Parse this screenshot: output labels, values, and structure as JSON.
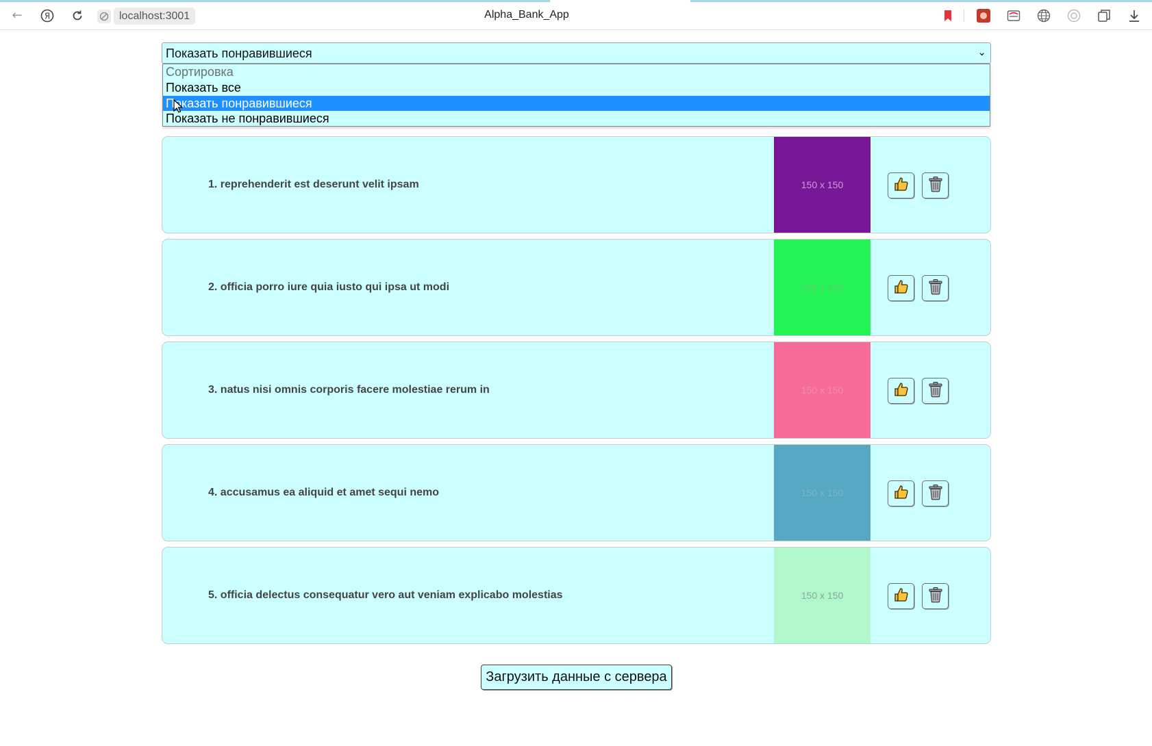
{
  "browser": {
    "url": "localhost:3001",
    "title": "Alpha_Bank_App",
    "icons": [
      "back-icon",
      "yandex-icon",
      "reload-icon",
      "site-info-icon",
      "bookmark-icon",
      "extension-icon",
      "reader-icon",
      "translate-icon",
      "alice-icon",
      "collections-icon",
      "download-icon"
    ]
  },
  "sort": {
    "selected": "Показать понравившиеся",
    "options": [
      {
        "label": "Сортировка",
        "disabled": true
      },
      {
        "label": "Показать все"
      },
      {
        "label": "Показать понравившиеся",
        "selected": true
      },
      {
        "label": "Показать не понравившиеся"
      }
    ]
  },
  "cards": [
    {
      "title": "1. reprehenderit est deserunt velit ipsam",
      "image_label": "150 x 150",
      "image_color": "#771796",
      "text_color": "#c99cd4"
    },
    {
      "title": "2. officia porro iure quia iusto qui ipsa ut modi",
      "image_label": "150 x 150",
      "image_color": "#24f355",
      "text_color": "#62c878"
    },
    {
      "title": "3. natus nisi omnis corporis facere molestiae rerum in",
      "image_label": "150 x 150",
      "image_color": "#f66b97",
      "text_color": "#f092ad"
    },
    {
      "title": "4. accusamus ea aliquid et amet sequi nemo",
      "image_label": "150 x 150",
      "image_color": "#56a8c2",
      "text_color": "#7cb6c8"
    },
    {
      "title": "5. officia delectus consequatur vero aut veniam explicabo molestias",
      "image_label": "150 x 150",
      "image_color": "#b0f7cc",
      "text_color": "#8aa996"
    }
  ],
  "card_icons": {
    "like": "thumbs-up-icon",
    "delete": "trash-icon"
  },
  "load_button": "Загрузить данные с сервера",
  "colors": {
    "card_bg": "#ccffff",
    "selected_option": "#1e90ff"
  }
}
